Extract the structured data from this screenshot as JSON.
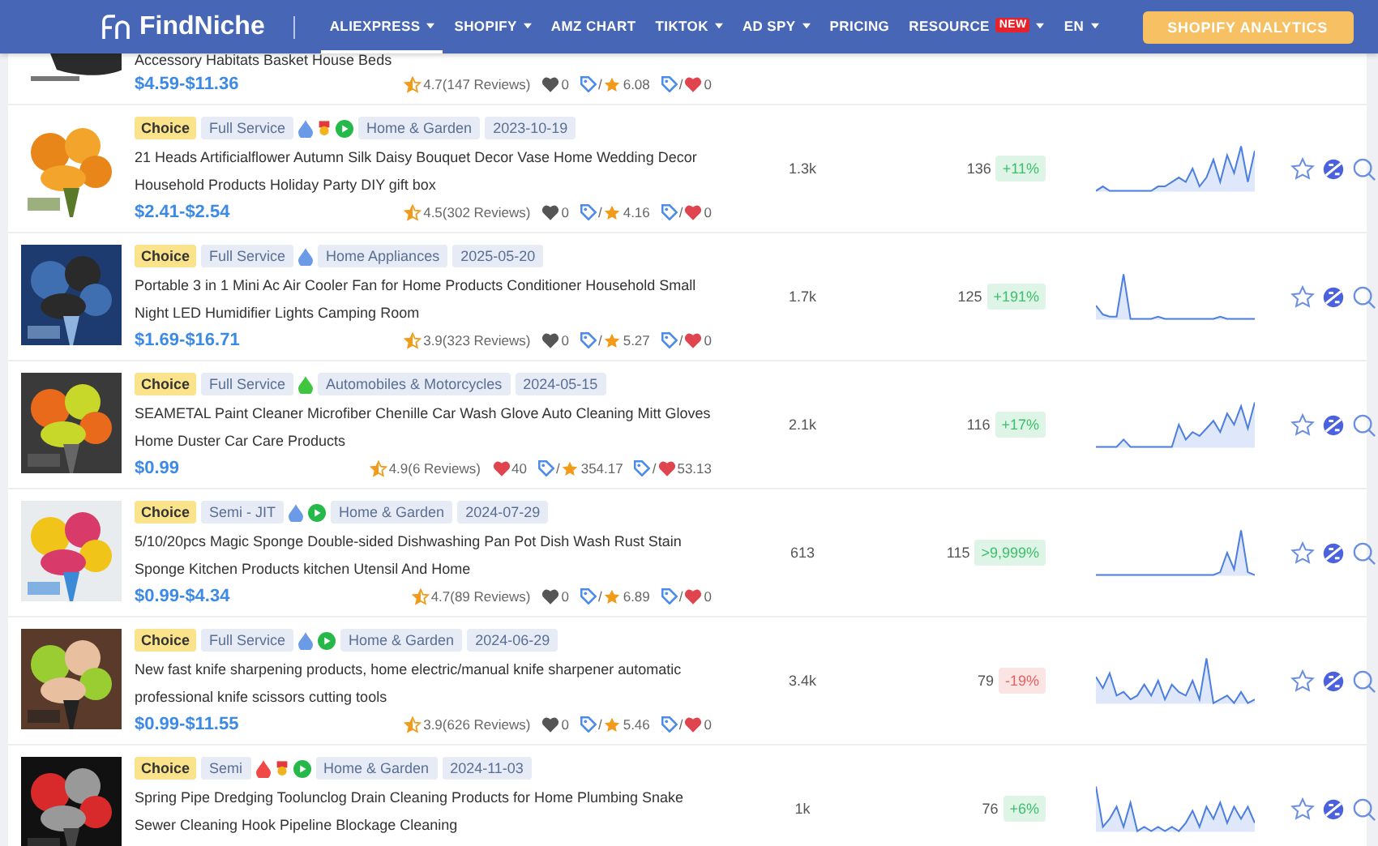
{
  "nav": {
    "logo": "FindNiche",
    "items": [
      {
        "label": "ALIEXPRESS",
        "selected": true,
        "caret": true
      },
      {
        "label": "SHOPIFY",
        "selected": false,
        "caret": true
      },
      {
        "label": "AMZ CHART",
        "selected": false,
        "caret": false
      },
      {
        "label": "TIKTOK",
        "selected": false,
        "caret": true
      },
      {
        "label": "AD SPY",
        "selected": false,
        "caret": true
      },
      {
        "label": "PRICING",
        "selected": false,
        "caret": false
      },
      {
        "label": "RESOURCE",
        "selected": false,
        "caret": true,
        "badge": "NEW"
      },
      {
        "label": "EN",
        "selected": false,
        "caret": true
      }
    ],
    "cta": "SHOPIFY ANALYTICS"
  },
  "top_row": {
    "title": "Accessory Habitats Basket House Beds",
    "price": "$4.59-$11.36",
    "rating": "4.7(147 Reviews)",
    "likes": "0",
    "favorite": false,
    "star_sep": "/",
    "star_value": "6.08",
    "heart_sep": "/",
    "heart_value": "0"
  },
  "products": [
    {
      "badge": "Choice",
      "service": "Full Service",
      "icons": [
        {
          "kind": "drop",
          "color": "#6b9be6"
        },
        {
          "kind": "medal"
        },
        {
          "kind": "play"
        }
      ],
      "category": "Home & Garden",
      "date": "2023-10-19",
      "title": "21 Heads Artificialflower Autumn Silk Daisy Bouquet Decor Vase Home Wedding Decor Household Products Holiday Party DIY gift box",
      "price": "$2.41-$2.54",
      "rating": "4.5(302 Reviews)",
      "likes": "0",
      "favorite": false,
      "star_sep": "/",
      "star_value": "4.16",
      "heart_sep": "/",
      "heart_value": "0",
      "sales": "1.3k",
      "orders": "136",
      "growth": "+11%",
      "color": "#3cbf6a"
    },
    {
      "badge": "Choice",
      "service": "Full Service",
      "icons": [
        {
          "kind": "drop",
          "color": "#6b9be6"
        }
      ],
      "category": "Home Appliances",
      "date": "2025-05-20",
      "title": "Portable 3 in 1 Mini Ac Air Cooler Fan for Home Products Conditioner Household Small Night LED Humidifier Lights Camping Room",
      "price": "$1.69-$16.71",
      "rating": "3.9(323 Reviews)",
      "likes": "0",
      "favorite": false,
      "star_sep": "/",
      "star_value": "5.27",
      "heart_sep": "/",
      "heart_value": "0",
      "sales": "1.7k",
      "orders": "125",
      "growth": "+191%",
      "color": "#3cbf6a"
    },
    {
      "badge": "Choice",
      "service": "Full Service",
      "icons": [
        {
          "kind": "drop",
          "color": "#3fc53f"
        }
      ],
      "category": "Automobiles & Motorcycles",
      "date": "2024-05-15",
      "title": "SEAMETAL Paint Cleaner Microfiber Chenille Car Wash Glove Auto Cleaning Mitt Gloves Home Duster Car Care Products",
      "price": "$0.99",
      "rating": "4.9(6 Reviews)",
      "likes": "40",
      "favorite": true,
      "star_sep": "/",
      "star_value": "354.17",
      "heart_sep": "/",
      "heart_value": "53.13",
      "sales": "2.1k",
      "orders": "116",
      "growth": "+17%",
      "color": "#3cbf6a"
    },
    {
      "badge": "Choice",
      "service": "Semi - JIT",
      "icons": [
        {
          "kind": "drop",
          "color": "#6b9be6"
        },
        {
          "kind": "play"
        }
      ],
      "category": "Home & Garden",
      "date": "2024-07-29",
      "title": "5/10/20pcs Magic Sponge Double-sided Dishwashing Pan Pot Dish Wash Rust Stain Sponge Kitchen Products kitchen Utensil And Home",
      "price": "$0.99-$4.34",
      "rating": "4.7(89 Reviews)",
      "likes": "0",
      "favorite": false,
      "star_sep": "/",
      "star_value": "6.89",
      "heart_sep": "/",
      "heart_value": "0",
      "sales": "613",
      "orders": "115",
      "growth": ">9,999%",
      "color": "#3cbf6a"
    },
    {
      "badge": "Choice",
      "service": "Full Service",
      "icons": [
        {
          "kind": "drop",
          "color": "#6b9be6"
        },
        {
          "kind": "play"
        }
      ],
      "category": "Home & Garden",
      "date": "2024-06-29",
      "title": "New fast knife sharpening products, home electric/manual knife sharpener automatic professional knife scissors cutting tools",
      "price": "$0.99-$11.55",
      "rating": "3.9(626 Reviews)",
      "likes": "0",
      "favorite": false,
      "star_sep": "/",
      "star_value": "5.46",
      "heart_sep": "/",
      "heart_value": "0",
      "sales": "3.4k",
      "orders": "79",
      "growth": "-19%",
      "color": "#e55f5f"
    },
    {
      "badge": "Choice",
      "service": "Semi",
      "icons": [
        {
          "kind": "drop",
          "color": "#f04848"
        },
        {
          "kind": "medal"
        },
        {
          "kind": "play"
        }
      ],
      "category": "Home & Garden",
      "date": "2024-11-03",
      "title": "Spring Pipe Dredging Toolunclog Drain Cleaning Products for Home Plumbing Snake Sewer Cleaning Hook Pipeline Blockage Cleaning",
      "sales": "1k",
      "orders": "76",
      "growth": "+6%",
      "color": "#3cbf6a"
    }
  ]
}
